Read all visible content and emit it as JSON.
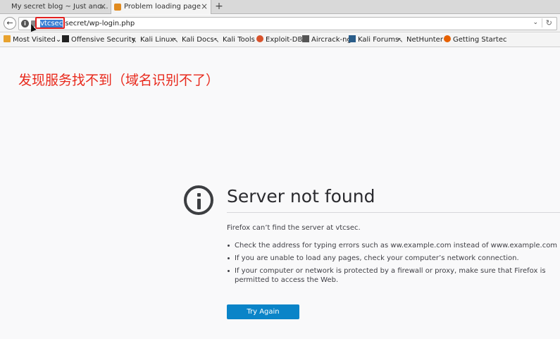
{
  "tabs": [
    {
      "label": "My secret blog ~ Just ano...",
      "close": "×"
    },
    {
      "label": "Problem loading page",
      "close": "×"
    }
  ],
  "newtab": "+",
  "nav": {
    "back": "←",
    "url_selected": "vtcsec",
    "url_rest": ".secret/wp-login.php",
    "dropdown": "⌄",
    "reload": "↻"
  },
  "bookmarks": [
    {
      "label": "Most Visited",
      "icon": "folder-icon"
    },
    {
      "label": "Offensive Security",
      "icon": "offsec-icon"
    },
    {
      "label": "Kali Linux",
      "icon": "kali-icon"
    },
    {
      "label": "Kali Docs",
      "icon": "kali-icon"
    },
    {
      "label": "Kali Tools",
      "icon": "kali-icon"
    },
    {
      "label": "Exploit-DB",
      "icon": "exploitdb-icon"
    },
    {
      "label": "Aircrack-ng",
      "icon": "aircrack-icon"
    },
    {
      "label": "Kali Forums",
      "icon": "forum-icon"
    },
    {
      "label": "NetHunter",
      "icon": "kali-icon"
    },
    {
      "label": "Getting Startec",
      "icon": "firefox-icon"
    }
  ],
  "most_visited_chevron": "⌄",
  "annotation": "发现服务找不到（域名识别不了）",
  "error": {
    "title": "Server not found",
    "lead": "Firefox can’t find the server at vtcsec.",
    "items": [
      "Check the address for typing errors such as ww.example.com instead of www.example.com",
      "If you are unable to load any pages, check your computer’s network connection.",
      "If your computer or network is protected by a firewall or proxy, make sure that Firefox is permitted to access the Web."
    ],
    "button": "Try Again"
  },
  "colors": {
    "annotation": "#e8291c",
    "button": "#0a84c8",
    "highlight": "#3a7fd5",
    "redbox": "#e02020"
  }
}
